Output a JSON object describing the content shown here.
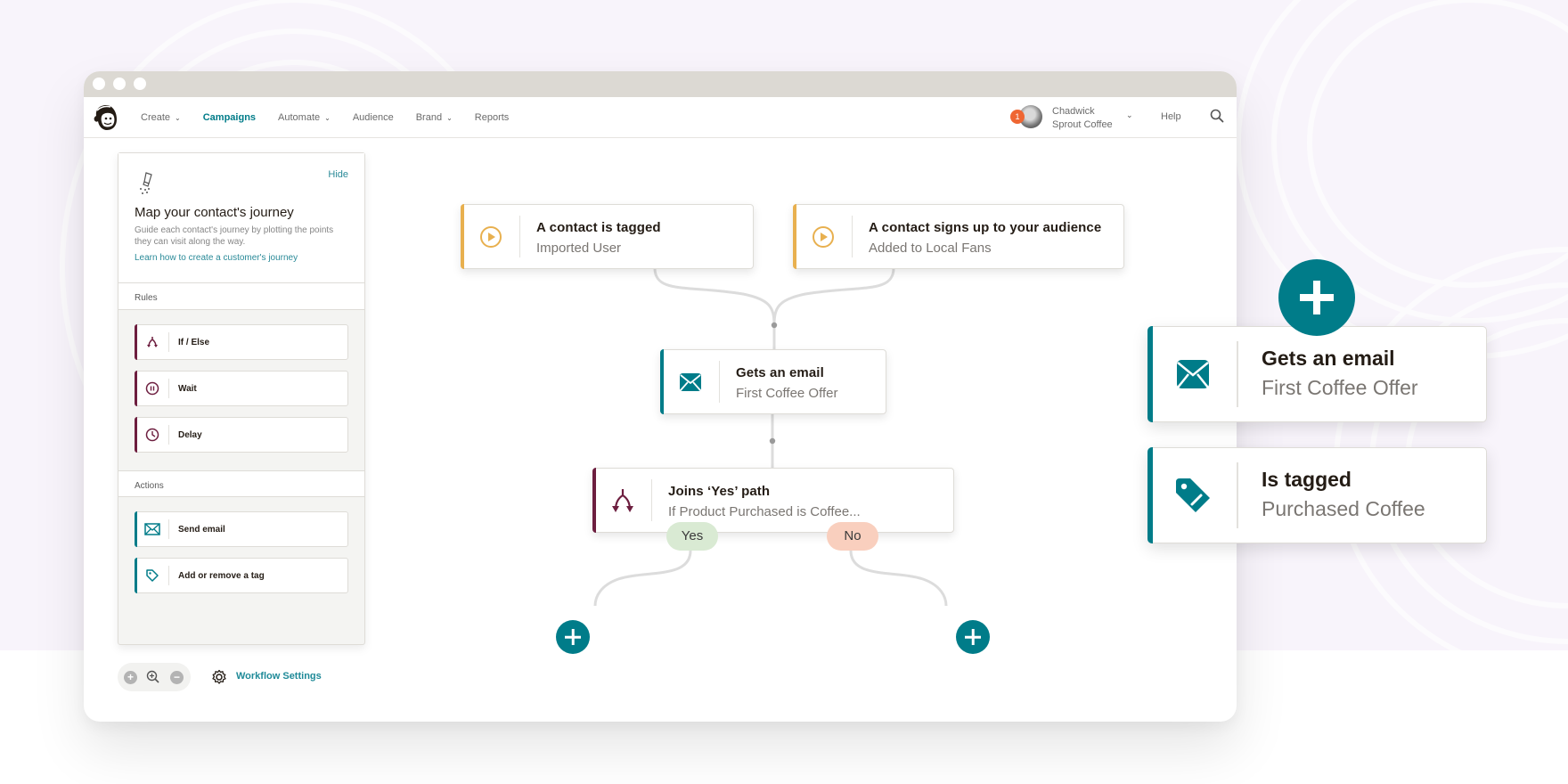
{
  "window": {
    "nav": {
      "items": [
        {
          "label": "Create",
          "dropdown": true,
          "active": false
        },
        {
          "label": "Campaigns",
          "dropdown": false,
          "active": true
        },
        {
          "label": "Automate",
          "dropdown": true,
          "active": false
        },
        {
          "label": "Audience",
          "dropdown": false,
          "active": false
        },
        {
          "label": "Brand",
          "dropdown": true,
          "active": false
        },
        {
          "label": "Reports",
          "dropdown": false,
          "active": false
        }
      ],
      "notification_count": "1",
      "user_name": "Chadwick",
      "user_company": "Sprout Coffee",
      "help_label": "Help",
      "logo_icon": "mailchimp-logo",
      "search_icon": "search-icon"
    },
    "panel": {
      "hide_label": "Hide",
      "intro_title": "Map your contact's journey",
      "intro_description": "Guide each contact's journey by plotting the points they can visit along the way.",
      "intro_link": "Learn how to create a customer's journey",
      "rules_heading": "Rules",
      "rules": [
        {
          "label": "If / Else",
          "icon": "branch-icon"
        },
        {
          "label": "Wait",
          "icon": "pause-icon"
        },
        {
          "label": "Delay",
          "icon": "clock-icon"
        }
      ],
      "actions_heading": "Actions",
      "actions": [
        {
          "label": "Send email",
          "icon": "envelope-icon"
        },
        {
          "label": "Add or remove a tag",
          "icon": "tag-icon"
        }
      ]
    },
    "toolbar": {
      "settings_label": "Workflow Settings"
    },
    "canvas": {
      "triggers": [
        {
          "title": "A contact is tagged",
          "subtitle": "Imported User",
          "icon": "play-icon"
        },
        {
          "title": "A contact signs up to your audience",
          "subtitle": "Added to Local Fans",
          "icon": "play-icon"
        }
      ],
      "email_step": {
        "title": "Gets an  email",
        "subtitle": "First Coffee Offer",
        "icon": "envelope-icon"
      },
      "branch_step": {
        "title": "Joins ‘Yes’ path",
        "subtitle": "If Product Purchased is Coffee...",
        "icon": "branch-icon"
      },
      "yes_label": "Yes",
      "no_label": "No"
    }
  },
  "floating": {
    "email_card": {
      "title": "Gets an  email",
      "subtitle": "First Coffee Offer",
      "icon": "envelope-icon"
    },
    "tag_card": {
      "title": "Is tagged",
      "subtitle": "Purchased Coffee",
      "icon": "tag-icon"
    }
  },
  "colors": {
    "teal": "#007c89",
    "trigger_yellow": "#e8b04f",
    "rule_maroon": "#6d1e3f",
    "yes_green": "#d9ead3",
    "no_peach": "#f9cfbe",
    "background_lavender": "#f8f4fb"
  }
}
